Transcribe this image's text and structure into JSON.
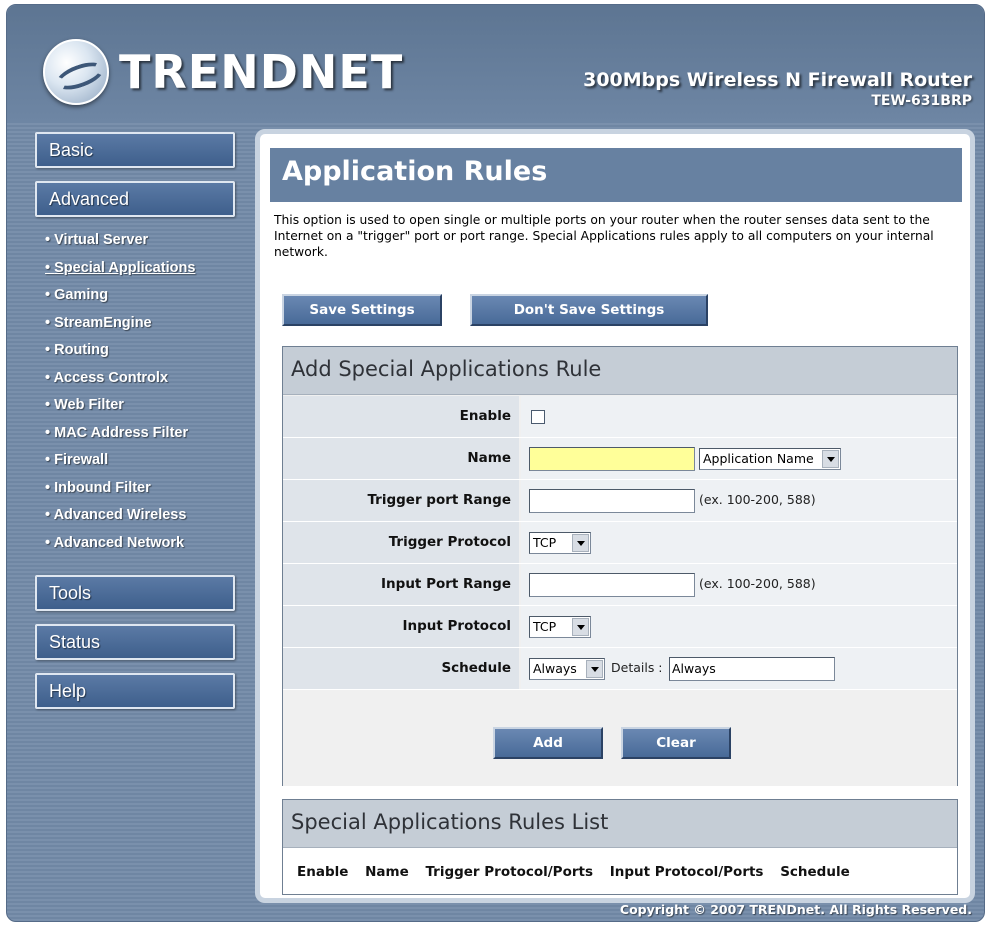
{
  "header": {
    "logo_text": "TRENDNET",
    "product_title": "300Mbps Wireless N Firewall Router",
    "product_model": "TEW-631BRP"
  },
  "sidebar": {
    "basic": "Basic",
    "advanced": "Advanced",
    "items": [
      "Virtual Server",
      "Special Applications",
      "Gaming",
      "StreamEngine",
      "Routing",
      "Access Controlx",
      "Web Filter",
      "MAC Address Filter",
      "Firewall",
      "Inbound Filter",
      "Advanced Wireless",
      "Advanced Network"
    ],
    "active_item": "Special Applications",
    "tools": "Tools",
    "status": "Status",
    "help": "Help"
  },
  "main": {
    "title": "Application Rules",
    "description": "This option is used to open single or multiple ports on your router when the router senses data sent to the Internet on a \"trigger\" port or port range. Special Applications rules apply to all computers on your internal network.",
    "save_label": "Save Settings",
    "dont_save_label": "Don't Save Settings"
  },
  "form": {
    "heading": "Add Special Applications Rule",
    "enable_label": "Enable",
    "enable_checked": false,
    "name_label": "Name",
    "name_value": "",
    "app_select": "Application Name",
    "trigger_range_label": "Trigger port Range",
    "trigger_range_value": "",
    "trigger_range_hint": "(ex. 100-200, 588)",
    "trigger_protocol_label": "Trigger Protocol",
    "trigger_protocol": "TCP",
    "input_range_label": "Input Port Range",
    "input_range_value": "",
    "input_range_hint": "(ex. 100-200, 588)",
    "input_protocol_label": "Input Protocol",
    "input_protocol": "TCP",
    "schedule_label": "Schedule",
    "schedule_value": "Always",
    "details_label": "Details :",
    "details_value": "Always",
    "add_label": "Add",
    "clear_label": "Clear"
  },
  "rules_list": {
    "heading": "Special Applications Rules List",
    "columns": [
      "Enable",
      "Name",
      "Trigger Protocol/Ports",
      "Input Protocol/Ports",
      "Schedule"
    ]
  },
  "footer": {
    "copyright": "Copyright © 2007 TRENDnet. All Rights Reserved."
  },
  "colors": {
    "frame": "#7186a2",
    "title_bar": "#6781a1",
    "section_head": "#c5cdd6",
    "name_field_highlight": "#ffff99",
    "button": "#4f709e"
  }
}
